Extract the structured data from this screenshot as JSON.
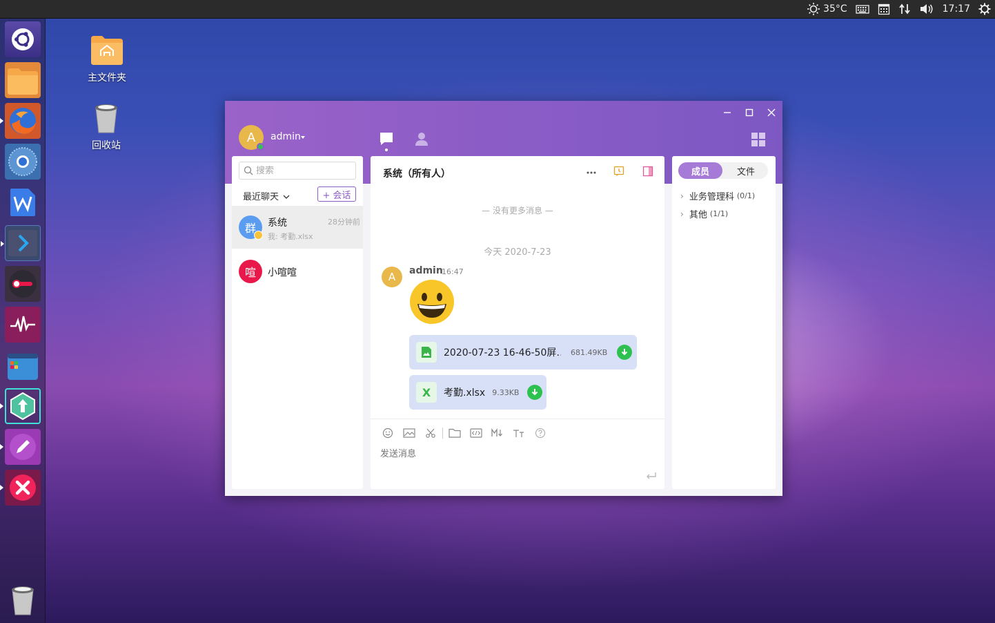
{
  "topbar": {
    "temperature": "35°C",
    "clock": "17:17"
  },
  "desktop": {
    "home_folder_label": "主文件夹",
    "trash_label": "回收站"
  },
  "window": {
    "user": {
      "avatar_letter": "A",
      "name": "admin"
    },
    "sidebar": {
      "search_placeholder": "搜索",
      "recent_label": "最近聊天",
      "new_chat_label": "+ 会话",
      "chats": [
        {
          "avatar": "群",
          "name": "系统",
          "preview": "我: 考勤.xlsx",
          "time": "28分钟前",
          "color": "#5a9cf0"
        },
        {
          "avatar": "喧",
          "name": "小喧喧",
          "preview": "",
          "time": "",
          "color": "#e8194a"
        }
      ]
    },
    "conversation": {
      "title": "系统（所有人）",
      "no_more": "— 没有更多消息 —",
      "date_divider": "今天 2020-7-23",
      "message": {
        "avatar_letter": "A",
        "sender": "admin",
        "time": "16:47"
      },
      "files": [
        {
          "name": "2020-07-23 16-46-50屏…",
          "size": "681.49KB",
          "type": "image"
        },
        {
          "name": "考勤.xlsx",
          "size": "9.33KB",
          "type": "excel"
        }
      ],
      "input_placeholder": "发送消息"
    },
    "right_panel": {
      "tab_members": "成员",
      "tab_files": "文件",
      "groups": [
        {
          "name": "业务管理科",
          "count": "(0/1)"
        },
        {
          "name": "其他",
          "count": "(1/1)"
        }
      ]
    }
  }
}
